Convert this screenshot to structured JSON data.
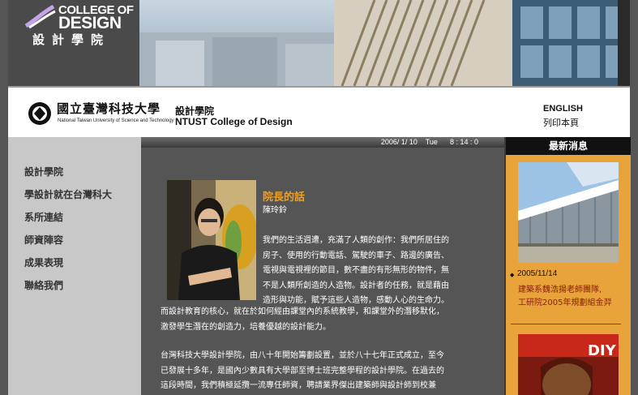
{
  "banner": {
    "logo_line1": "COLLEGE OF",
    "logo_line2": "DESIGN",
    "logo_chinese": "設計學院"
  },
  "title_strip": {
    "university_zh": "國立臺灣科技大學",
    "university_en": "National Taiwan University of Science and Technology",
    "college_zh": "設計學院",
    "college_en": "NTUST College of Design",
    "link_english": "ENGLISH",
    "link_print": "列印本頁"
  },
  "nav": {
    "items": [
      "設計學院",
      "學設計就在台灣科大",
      "系所連結",
      "師資陣容",
      "成果表現",
      "聯絡我們"
    ]
  },
  "main": {
    "date": "2006/ 1/ 10",
    "weekday": "Tue",
    "time": "8 : 14 : 0",
    "message_title": "院長的話",
    "message_author": "陳玲鈴",
    "para1": [
      "我們的生活週遭，充滿了人類的創作：我們所居住的",
      "房子、使用的行動電話、駕駛的車子、路邊的廣告、",
      "電視與電視裡的節目，數不盡的有形無形的物件，無",
      "不是人類所創造的人造物。設計者的任務，就是藉由",
      "造形與功能，賦予這些人造物，感動人心的生命力。"
    ],
    "para1_full": [
      "而設計教育的核心，就在於如何經由課堂內的系統教學，和課堂外的潛移默化，",
      "激發學生潛在的創造力，培養優越的設計能力。"
    ],
    "para2": [
      "台灣科技大學設計學院，由八十年開始籌劃設置，並於八十七年正式成立，至今",
      "已發展十多年，是國內少數具有大學部至博士班完整學程的設計學院。在過去的",
      "這段時間，我們積極延攬一流專任師資，聘請業界傑出建築師與設計師到校兼"
    ]
  },
  "news": {
    "header": "最新消息",
    "date": "2005/11/14",
    "lines": [
      "建築系魏浩揚老師團隊,",
      "工研院2005年規劃組金羿"
    ],
    "bullet": "◆",
    "thumb2_text": "DIY"
  }
}
